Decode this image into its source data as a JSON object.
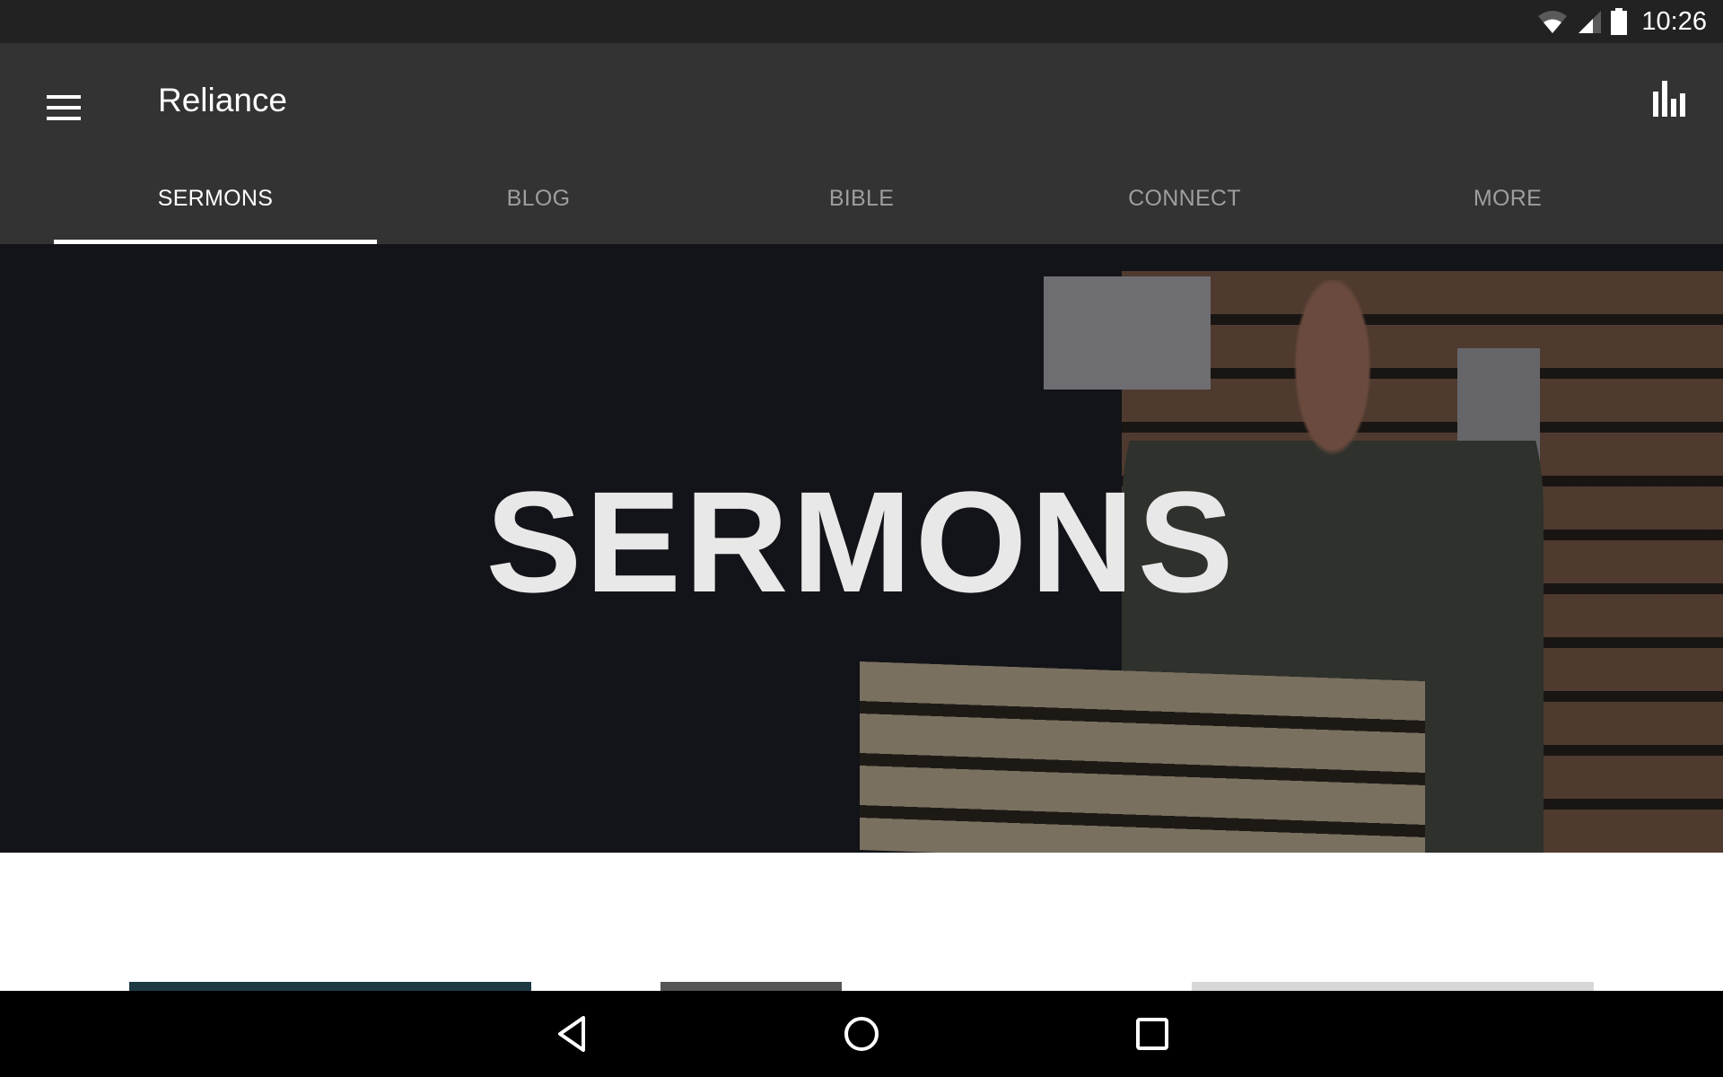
{
  "status_bar": {
    "time": "10:26",
    "icons": [
      "wifi-icon",
      "cell-signal-icon",
      "battery-icon"
    ]
  },
  "app_bar": {
    "title": "Reliance",
    "menu_icon": "hamburger-menu-icon",
    "action_icon": "bar-chart-icon"
  },
  "tabs": [
    {
      "label": "SERMONS",
      "active": true
    },
    {
      "label": "BLOG",
      "active": false
    },
    {
      "label": "BIBLE",
      "active": false
    },
    {
      "label": "CONNECT",
      "active": false
    },
    {
      "label": "MORE",
      "active": false
    }
  ],
  "hero": {
    "title": "SERMONS"
  },
  "nav_bar": {
    "buttons": [
      "back-icon",
      "home-icon",
      "recents-icon"
    ]
  },
  "colors": {
    "status_bar": "#222222",
    "app_bar": "#333333",
    "tab_active": "#ffffff",
    "tab_inactive": "#9e9e9e",
    "hero_bg": "#131419",
    "nav_bar": "#000000"
  }
}
